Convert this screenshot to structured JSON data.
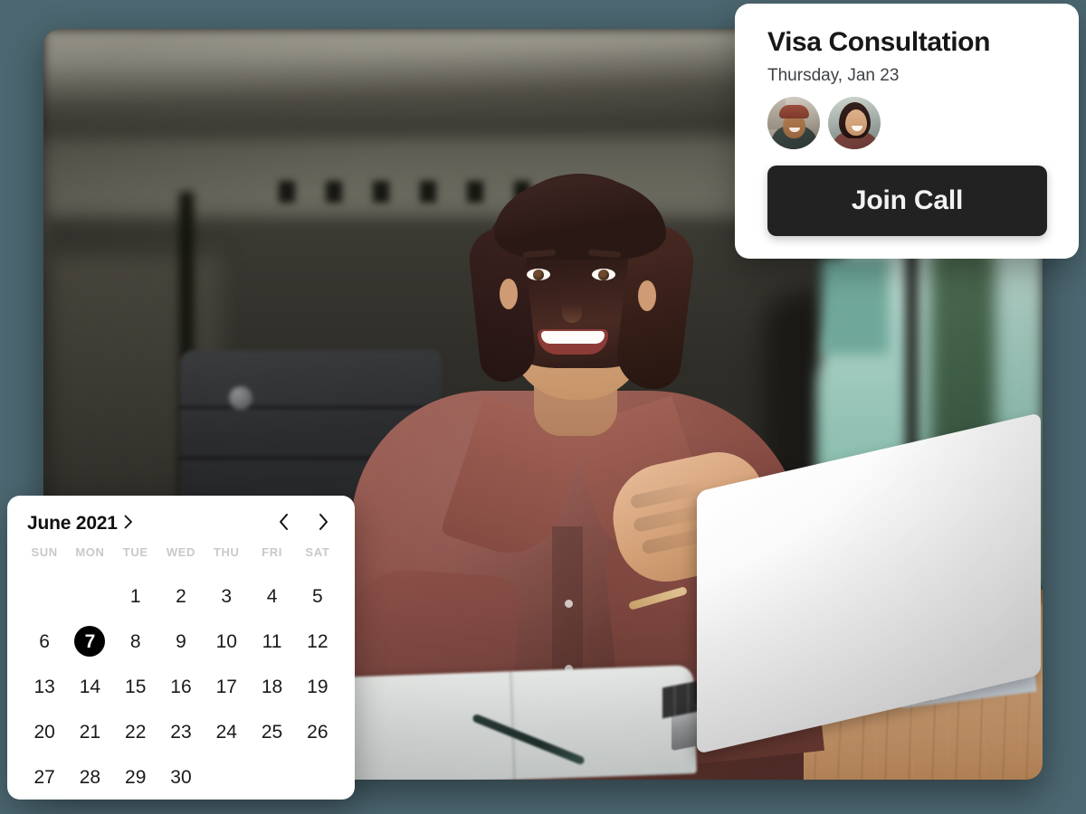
{
  "theme": {
    "background": "#4c6771",
    "card_bg": "#ffffff",
    "accent_dark": "#222222",
    "selected_day_bg": "#000000",
    "muted_text": "#c9c9c9"
  },
  "appointment_card": {
    "title": "Visa Consultation",
    "date": "Thursday, Jan 23",
    "attendees": [
      {
        "name": "attendee-1"
      },
      {
        "name": "attendee-2"
      }
    ],
    "join_button_label": "Join Call"
  },
  "calendar_card": {
    "month_label": "June 2021",
    "month_chevron": "chevron-right-icon",
    "prev_icon": "chevron-left-icon",
    "next_icon": "chevron-right-icon",
    "weekday_headers": [
      "SUN",
      "MON",
      "TUE",
      "WED",
      "THU",
      "FRI",
      "SAT"
    ],
    "leading_blanks": 2,
    "days": [
      1,
      2,
      3,
      4,
      5,
      6,
      7,
      8,
      9,
      10,
      11,
      12,
      13,
      14,
      15,
      16,
      17,
      18,
      19,
      20,
      21,
      22,
      23,
      24,
      25,
      26,
      27,
      28,
      29,
      30
    ],
    "selected_day": 7
  },
  "hero_photo": {
    "alt": "Smiling woman with short dark hair in a maroon shirt sitting at a wooden desk with an open laptop and notebook in a bright office"
  }
}
